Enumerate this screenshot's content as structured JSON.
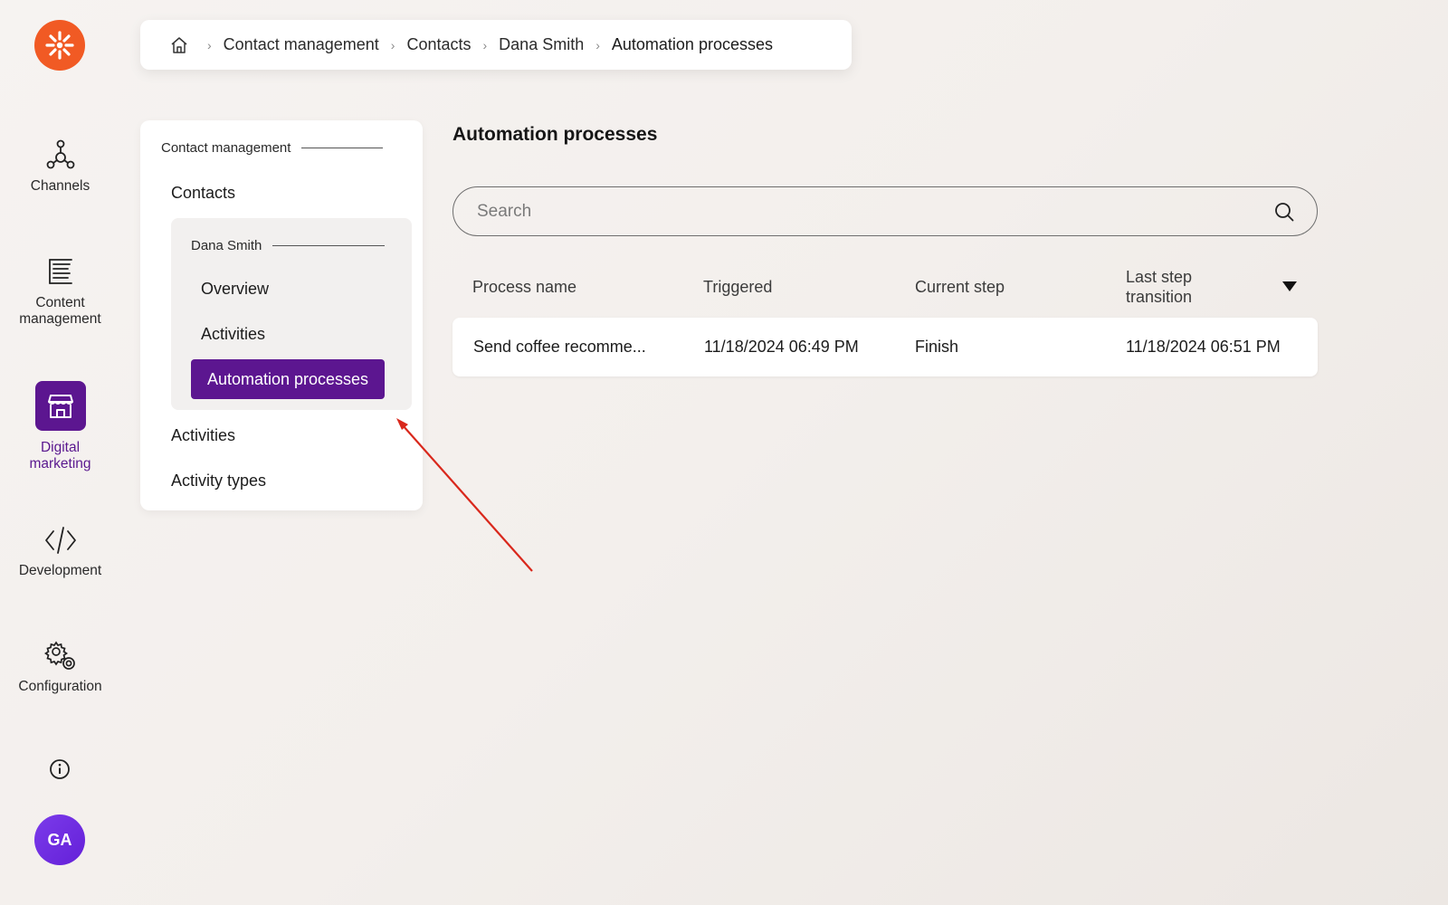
{
  "rail": {
    "items": [
      {
        "label_line1": "Channels",
        "label_line2": ""
      },
      {
        "label_line1": "Content",
        "label_line2": "management"
      },
      {
        "label_line1": "Digital",
        "label_line2": "marketing"
      },
      {
        "label_line1": "Development",
        "label_line2": ""
      },
      {
        "label_line1": "Configuration",
        "label_line2": ""
      }
    ],
    "avatar_initials": "GA",
    "accent": "#5c1690",
    "logo_color": "#f15a24"
  },
  "breadcrumb": {
    "items": [
      "Contact management",
      "Contacts",
      "Dana Smith",
      "Automation processes"
    ]
  },
  "nav": {
    "section_title": "Contact management",
    "contacts": "Contacts",
    "contact_name": "Dana Smith",
    "overview": "Overview",
    "activities_sub": "Activities",
    "automation_processes": "Automation processes",
    "activities": "Activities",
    "activity_types": "Activity types"
  },
  "main": {
    "title": "Automation processes",
    "search_placeholder": "Search",
    "columns": {
      "process_name": "Process name",
      "triggered": "Triggered",
      "current_step": "Current step",
      "last_step_line1": "Last step",
      "last_step_line2": "transition"
    },
    "rows": [
      {
        "process_name": "Send coffee recomme...",
        "triggered": "11/18/2024 06:49 PM",
        "current_step": "Finish",
        "last_step_transition": "11/18/2024 06:51 PM"
      }
    ]
  },
  "annotation_color": "#d9281c"
}
